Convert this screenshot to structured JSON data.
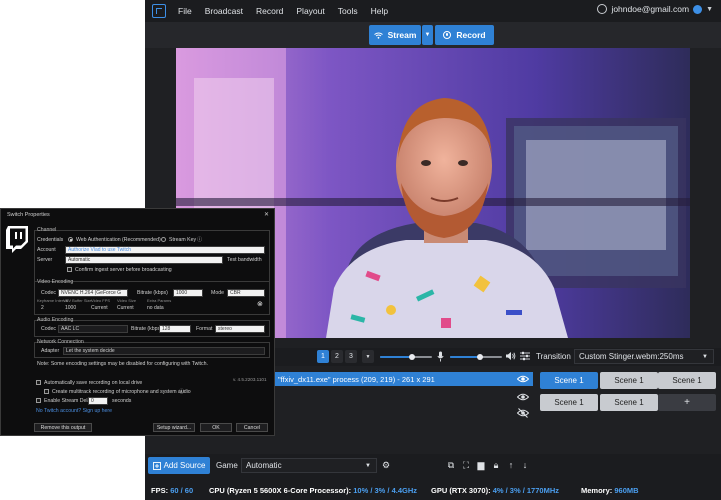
{
  "menu": {
    "items": [
      "File",
      "Broadcast",
      "Record",
      "Playout",
      "Tools",
      "Help"
    ],
    "account_email": "johndoe@gmail.com"
  },
  "toolbar": {
    "stream_label": "Stream",
    "record_label": "Record"
  },
  "scene_tabs": [
    "1",
    "2",
    "3"
  ],
  "mixer": {
    "mic_level": 0.62,
    "desktop_level": 0.58
  },
  "transition": {
    "label": "Transition",
    "value": "Custom Stinger.webm:250ms"
  },
  "sources": {
    "selected_item": "\"ffxiv_dx11.exe\" process (209, 219) - 261 x 291"
  },
  "scenes": {
    "items": [
      "Scene 1",
      "Scene 1",
      "Scene 1",
      "Scene 1",
      "Scene 1"
    ],
    "add_label": "+"
  },
  "bottom": {
    "add_source_label": "Add Source",
    "game_label": "Game",
    "game_value": "Automatic"
  },
  "status": {
    "fps_label": "FPS:",
    "fps_value": "60 / 60",
    "cpu_label": "CPU (Ryzen 5 5600X 6-Core Processor):",
    "cpu_value": "10% / 3% / 4.4GHz",
    "gpu_label": "GPU (RTX 3070):",
    "gpu_value": "4% / 3% / 1770MHz",
    "memory_label": "Memory:",
    "memory_value": "960MB"
  },
  "dialog": {
    "title": "Switch Properties",
    "channel_group": "Channel",
    "credentials_label": "Credentials",
    "web_auth_label": "Web Authentication (Recommended)",
    "stream_key_label": "Stream Key",
    "account_label": "Account",
    "account_value": "Authorize Vlad to use Twitch",
    "server_label": "Server",
    "server_value": "Automatic",
    "test_bandwidth": "Test bandwidth",
    "confirm_ingest": "Confirm ingest server before broadcasting",
    "video_group": "Video Encoding",
    "codec_label": "Codec",
    "video_codec_value": "NVENC H.264 (GeForce G",
    "bitrate_label": "Bitrate (kbps)",
    "video_bitrate_value": "1000",
    "mode_label": "Mode",
    "mode_value": "CBR",
    "keyframe_label": "Keyframe Interval",
    "vbv_label": "VBV Buffer Size",
    "video_fps_label": "Video FPS",
    "video_size_label": "Video Size",
    "extra_params_label": "Extra Params",
    "keyframe_value": "2",
    "vbv_value": "1000",
    "fps_value": "Current",
    "size_value": "Current",
    "extra_value": "no data",
    "audio_group": "Audio Encoding",
    "audio_codec_value": "AAC LC",
    "audio_bitrate_value": "128",
    "format_label": "Format",
    "format_value": "stereo",
    "network_group": "Network Connection",
    "adapter_label": "Adapter",
    "adapter_value": "Let the system decide",
    "note": "Note: Some encoding settings may be disabled for configuring with Twitch.",
    "version": "v. 4.5.2203.1101",
    "auto_save": "Automatically save recording on local drive",
    "multitrack": "Create multitrack recording of microphone and system audio",
    "stream_delay": "Enable Stream Delay",
    "delay_value": "0",
    "seconds": "seconds",
    "no_account": "No Twitch account? Sign up here",
    "remove_output": "Remove this output",
    "setup_wizard": "Setup wizard...",
    "ok": "OK",
    "cancel": "Cancel"
  },
  "colors": {
    "accent": "#2f81d5",
    "twitch": "#9146ff",
    "bg": "#1f2023"
  }
}
